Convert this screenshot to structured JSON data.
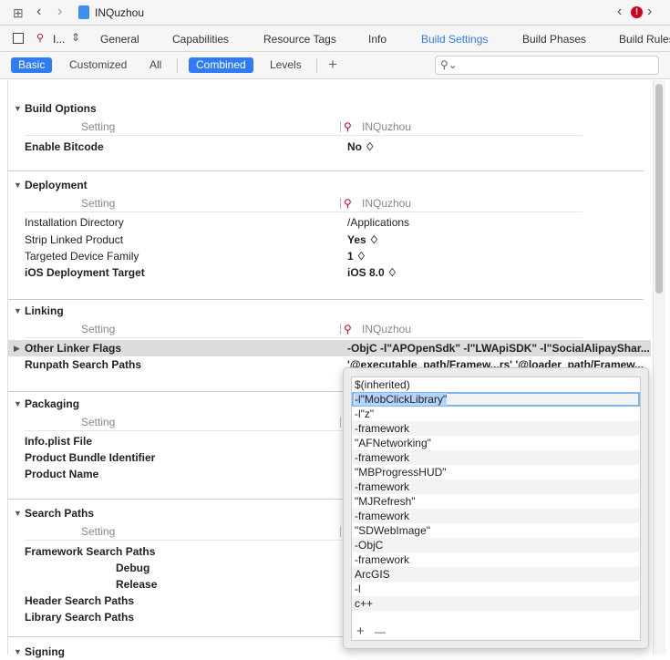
{
  "window": {
    "project_title": "INQuzhou",
    "target_label": "I..."
  },
  "tabs": [
    "General",
    "Capabilities",
    "Resource Tags",
    "Info",
    "Build Settings",
    "Build Phases",
    "Build Rules"
  ],
  "active_tab": "Build Settings",
  "filters": {
    "basic": "Basic",
    "customized": "Customized",
    "all": "All",
    "combined": "Combined",
    "levels": "Levels",
    "add": "+",
    "search_placeholder": ""
  },
  "sections": [
    {
      "title": "Build Options",
      "header_setting": "Setting",
      "target": "INQuzhou",
      "rows": [
        {
          "label": "Enable Bitcode",
          "value": "No ♢",
          "bold": true
        }
      ]
    },
    {
      "title": "Deployment",
      "header_setting": "Setting",
      "target": "INQuzhou",
      "rows": [
        {
          "label": "Installation Directory",
          "value": "/Applications"
        },
        {
          "label": "Strip Linked Product",
          "value": "Yes ♢"
        },
        {
          "label": "Targeted Device Family",
          "value": "1 ♢"
        },
        {
          "label": "iOS Deployment Target",
          "value": "iOS 8.0 ♢",
          "bold": true
        }
      ]
    },
    {
      "title": "Linking",
      "header_setting": "Setting",
      "target": "INQuzhou",
      "rows": [
        {
          "label": "Other Linker Flags",
          "value": "-ObjC -l\"APOpenSdk\" -l\"LWApiSDK\" -l\"SocialAlipayShar...",
          "bold": true,
          "selected": true
        },
        {
          "label": "Runpath Search Paths",
          "value": "'@executable_path/Framew...rs' '@loader_path/Framew...",
          "bold": true
        }
      ]
    },
    {
      "title": "Packaging",
      "header_setting": "Setting",
      "rows": [
        {
          "label": "Info.plist File",
          "bold": true
        },
        {
          "label": "Product Bundle Identifier",
          "bold": true
        },
        {
          "label": "Product Name",
          "bold": true
        }
      ]
    },
    {
      "title": "Search Paths",
      "header_setting": "Setting",
      "rows": [
        {
          "label": "Framework Search Paths",
          "bold": true
        },
        {
          "label": "Debug",
          "bold": true,
          "indent": true
        },
        {
          "label": "Release",
          "bold": true,
          "indent": true
        },
        {
          "label": "Header Search Paths",
          "bold": true
        },
        {
          "label": "Library Search Paths",
          "bold": true
        }
      ]
    },
    {
      "title": "Signing",
      "rows": []
    }
  ],
  "popup": {
    "items": [
      "$(inherited)",
      "-l\"MobClickLibrary\"",
      "-l\"z\"",
      "-framework",
      "\"AFNetworking\"",
      "-framework",
      "\"MBProgressHUD\"",
      "-framework",
      "\"MJRefresh\"",
      "-framework",
      "\"SDWebImage\"",
      "-ObjC",
      "-framework",
      "ArcGIS",
      "-l",
      "c++"
    ],
    "selected_index": 1,
    "add": "+",
    "remove": "—"
  }
}
